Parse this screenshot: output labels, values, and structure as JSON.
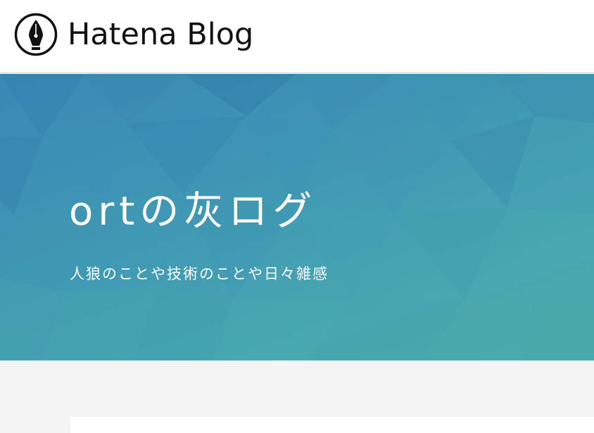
{
  "header": {
    "logo_text": "Hatena Blog",
    "logo_icon": "fountain-pen-nib-icon"
  },
  "hero": {
    "title": "ortの灰ログ",
    "description": "人狼のことや技術のことや日々雑感",
    "colors": {
      "start": "#3a88b6",
      "end": "#4aa9a9"
    }
  },
  "colors": {
    "page_background": "#f4f4f4",
    "header_background": "#ffffff",
    "text_dark": "#111111",
    "text_light": "#ffffff"
  }
}
